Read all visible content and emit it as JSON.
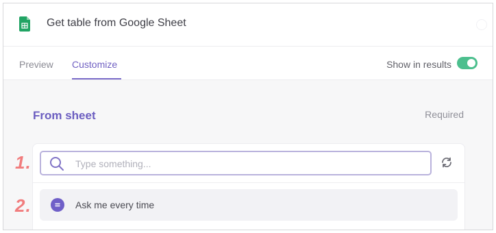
{
  "header": {
    "title": "Get table from Google Sheet",
    "icon": "google-sheets-icon",
    "accent": "#21a464"
  },
  "tabs": [
    {
      "label": "Preview",
      "active": false
    },
    {
      "label": "Customize",
      "active": true
    }
  ],
  "show_in_results": {
    "label": "Show in results",
    "enabled": true,
    "color": "#4cbf8e"
  },
  "section": {
    "title": "From sheet",
    "required_label": "Required"
  },
  "search": {
    "placeholder": "Type something..."
  },
  "options": [
    {
      "label": "Ask me every time",
      "icon": "chat-icon"
    }
  ],
  "annotations": [
    "1.",
    "2."
  ]
}
